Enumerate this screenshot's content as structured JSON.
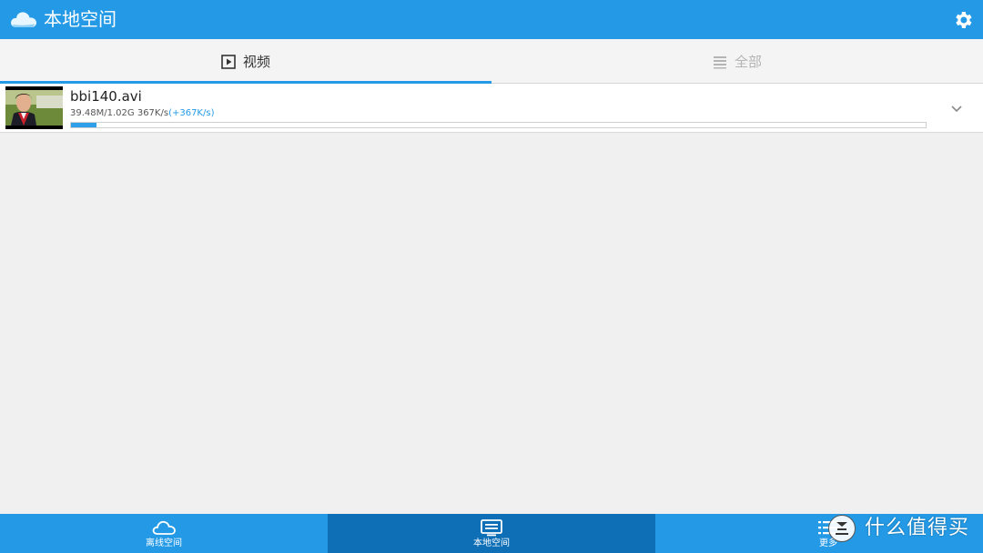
{
  "topbar": {
    "title": "本地空间",
    "logo_icon": "cloud-logo-icon",
    "settings_icon": "gear-icon",
    "color": "#249ae6"
  },
  "tabs": [
    {
      "label": "视频",
      "icon": "play-box-icon",
      "active": true
    },
    {
      "label": "全部",
      "icon": "list-icon",
      "active": false
    }
  ],
  "downloads": [
    {
      "name": "bbi140.avi",
      "size_progress": "39.48M/1.02G",
      "speed": "367K/s",
      "speed_delta": "(+367K/s)",
      "progress": 0.03,
      "thumbnail_icon": "video-thumbnail",
      "expand_icon": "chevron-down-icon"
    }
  ],
  "bottom_nav": [
    {
      "label": "离线空间",
      "icon": "cloud-icon",
      "active": false
    },
    {
      "label": "本地空间",
      "icon": "local-storage-icon",
      "active": true
    },
    {
      "label": "更多",
      "icon": "list-menu-icon",
      "active": false
    }
  ],
  "watermark": {
    "text": "什么值得买",
    "icon": "smzdm-logo-icon"
  }
}
